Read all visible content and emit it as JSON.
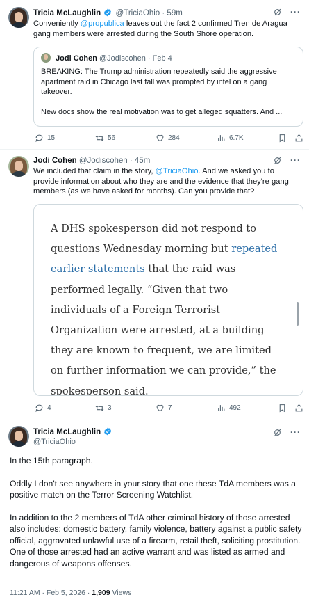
{
  "tweet1": {
    "name": "Tricia McLaughlin",
    "handle": "@TriciaOhio",
    "time": "· 59m",
    "text_before": "Conveniently ",
    "mention": "@propublica",
    "text_after": " leaves out the fact 2 confirmed Tren de Aragua gang members were arrested during the South Shore operation.",
    "quote": {
      "name": "Jodi Cohen",
      "handle": "@Jodiscohen",
      "time": "· Feb 4",
      "para1": "BREAKING: The Trump administration repeatedly said the aggressive apartment raid in Chicago last fall was prompted by intel on a gang takeover.",
      "para2": "New docs show the real motivation was to get alleged squatters. And ..."
    },
    "actions": {
      "replies": "15",
      "reposts": "56",
      "likes": "284",
      "views": "6.7K"
    }
  },
  "tweet2": {
    "name": "Jodi Cohen",
    "handle": "@Jodiscohen",
    "time": "· 45m",
    "text_before": "We included that claim in the story, ",
    "mention": "@TriciaOhio",
    "text_after": ". And we asked you to provide information about who they are and the evidence that they're gang members (as we have asked for months). Can you provide that?",
    "image_text": {
      "before": "A DHS spokesperson did not respond to questions Wednesday morning but ",
      "link": "repeated earlier statements",
      "after": " that the raid was performed legally. “Given that two individuals of a Foreign Terrorist Organization were arrested, at a building they are known to frequent, we are limited on further information we can provide,” the spokesperson said."
    },
    "actions": {
      "replies": "4",
      "reposts": "3",
      "likes": "7",
      "views": "492"
    }
  },
  "tweet3": {
    "name": "Tricia McLaughlin",
    "handle": "@TriciaOhio",
    "para1": "In the 15th paragraph.",
    "para2": "Oddly I don't see anywhere in your story that one these TdA members was a positive match on the Terror Screening Watchlist.",
    "para3": "In addition to the 2 members of TdA other criminal history of those arrested also includes: domestic battery, family violence, battery against a public safety official, aggravated unlawful use of a firearm, retail theft, soliciting prostitution. One of those arrested had an active warrant and was listed as armed and dangerous of weapons offenses.",
    "timestamp": "11:21 AM · Feb 5, 2026 · ",
    "views_count": "1,909",
    "views_label": " Views"
  },
  "colors": {
    "accent": "#1d9bf0",
    "text": "#0f1419",
    "muted": "#536471",
    "border": "#cfd9de"
  },
  "icons": [
    "verified-badge-icon",
    "grok-icon",
    "more-icon",
    "reply-icon",
    "repost-icon",
    "like-icon",
    "views-icon",
    "bookmark-icon",
    "share-icon"
  ]
}
